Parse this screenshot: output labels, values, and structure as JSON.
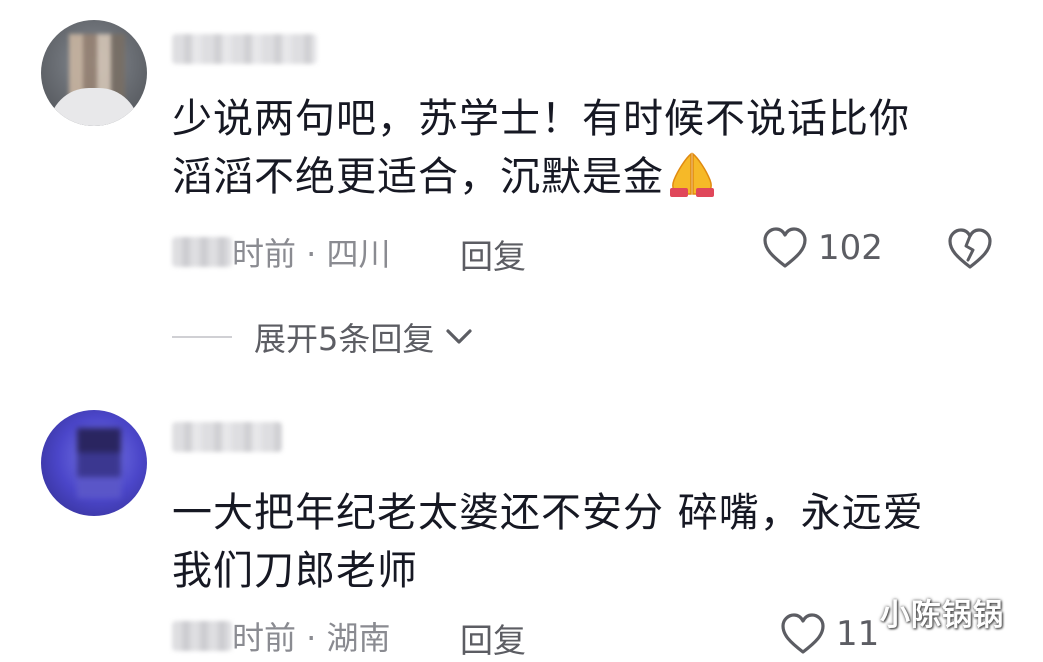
{
  "comments": [
    {
      "text_line1": "少说两句吧，苏学士！有时候不说话比你",
      "text_line2": "滔滔不绝更适合，沉默是金",
      "meta": "时前 · 四川",
      "reply_label": "回复",
      "like_count": "102",
      "expand_label": "展开5条回复"
    },
    {
      "text_line1": "一大把年纪老太婆还不安分  碎嘴，永远爱",
      "text_line2": "我们刀郎老师",
      "meta": "时前 · 湖南",
      "reply_label": "回复",
      "like_count": "11"
    }
  ],
  "watermark": "小陈锅锅",
  "icons": {
    "like": "heart-outline-icon",
    "dislike": "broken-heart-icon",
    "expand": "chevron-down-icon",
    "emoji": "folded-hands-emoji"
  },
  "colors": {
    "text_primary": "#161823",
    "text_secondary": "#8a8b91",
    "action": "#5c5d63"
  }
}
